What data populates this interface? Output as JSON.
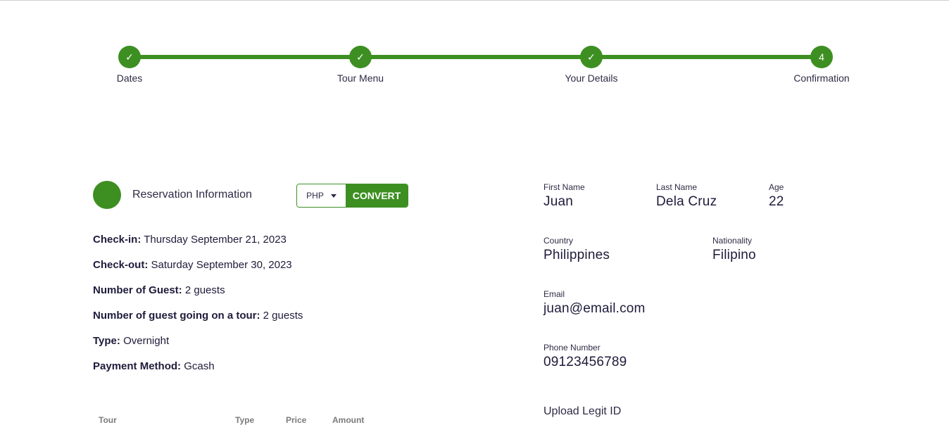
{
  "stepper": {
    "steps": [
      {
        "label": "Dates",
        "marker": "✓"
      },
      {
        "label": "Tour Menu",
        "marker": "✓"
      },
      {
        "label": "Your Details",
        "marker": "✓"
      },
      {
        "label": "Confirmation",
        "marker": "4"
      }
    ],
    "accent_color": "#3d8f22"
  },
  "reservation": {
    "title": "Reservation Information",
    "currency": "PHP",
    "convert_label": "CONVERT",
    "details": [
      {
        "label": "Check-in:",
        "value": "Thursday September 21, 2023"
      },
      {
        "label": "Check-out:",
        "value": "Saturday September 30, 2023"
      },
      {
        "label": "Number of Guest:",
        "value": "2 guests"
      },
      {
        "label": "Number of guest going on a tour:",
        "value": "2 guests"
      },
      {
        "label": "Type:",
        "value": "Overnight"
      },
      {
        "label": "Payment Method:",
        "value": "Gcash"
      }
    ],
    "table_headers": [
      "Tour",
      "Type",
      "Price",
      "Amount"
    ]
  },
  "guest": {
    "first_name": {
      "label": "First Name",
      "value": "Juan"
    },
    "last_name": {
      "label": "Last Name",
      "value": "Dela Cruz"
    },
    "age": {
      "label": "Age",
      "value": "22"
    },
    "country": {
      "label": "Country",
      "value": "Philippines"
    },
    "nationality": {
      "label": "Nationality",
      "value": "Filipino"
    },
    "email": {
      "label": "Email",
      "value": "juan@email.com"
    },
    "phone": {
      "label": "Phone Number",
      "value": "09123456789"
    },
    "upload_label": "Upload Legit ID"
  }
}
